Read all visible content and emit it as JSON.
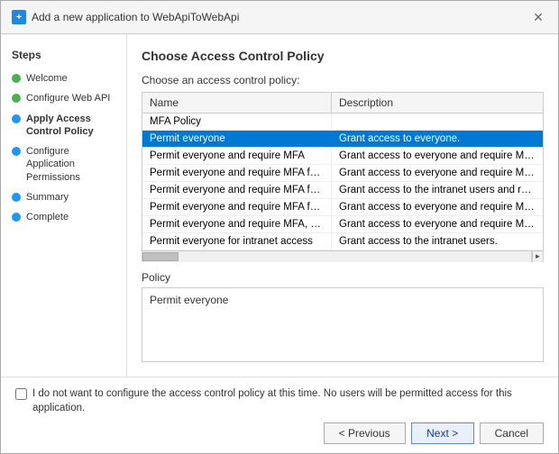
{
  "dialog": {
    "title": "Add a new application to WebApiToWebApi",
    "close_label": "✕"
  },
  "page_heading": "Choose Access Control Policy",
  "sidebar": {
    "title": "Steps",
    "items": [
      {
        "id": "welcome",
        "label": "Welcome",
        "dot": "green"
      },
      {
        "id": "configure-web-api",
        "label": "Configure Web API",
        "dot": "green"
      },
      {
        "id": "apply-access-control",
        "label": "Apply Access Control Policy",
        "dot": "blue",
        "bold": true
      },
      {
        "id": "configure-app-perms",
        "label": "Configure Application Permissions",
        "dot": "blue"
      },
      {
        "id": "summary",
        "label": "Summary",
        "dot": "blue"
      },
      {
        "id": "complete",
        "label": "Complete",
        "dot": "blue"
      }
    ]
  },
  "table": {
    "section_label": "Choose an access control policy:",
    "columns": [
      {
        "id": "name",
        "label": "Name"
      },
      {
        "id": "description",
        "label": "Description"
      }
    ],
    "rows": [
      {
        "name": "MFA Policy",
        "description": "",
        "selected": false
      },
      {
        "name": "Permit everyone",
        "description": "Grant access to everyone.",
        "selected": true
      },
      {
        "name": "Permit everyone and require MFA",
        "description": "Grant access to everyone and require MFA f...",
        "selected": false
      },
      {
        "name": "Permit everyone and require MFA for specific group",
        "description": "Grant access to everyone and require MFA f...",
        "selected": false
      },
      {
        "name": "Permit everyone and require MFA from extranet access",
        "description": "Grant access to the intranet users and requir...",
        "selected": false
      },
      {
        "name": "Permit everyone and require MFA from unauthenticated ...",
        "description": "Grant access to everyone and require MFA f...",
        "selected": false
      },
      {
        "name": "Permit everyone and require MFA, allow automatic devi...",
        "description": "Grant access to everyone and require MFA f...",
        "selected": false
      },
      {
        "name": "Permit everyone for intranet access",
        "description": "Grant access to the intranet users.",
        "selected": false
      }
    ]
  },
  "policy": {
    "label": "Policy",
    "value": "Permit everyone"
  },
  "checkbox": {
    "label": "I do not want to configure the access control policy at this time.  No users will be permitted access for this application.",
    "checked": false
  },
  "buttons": {
    "previous": "< Previous",
    "next": "Next >",
    "cancel": "Cancel"
  }
}
